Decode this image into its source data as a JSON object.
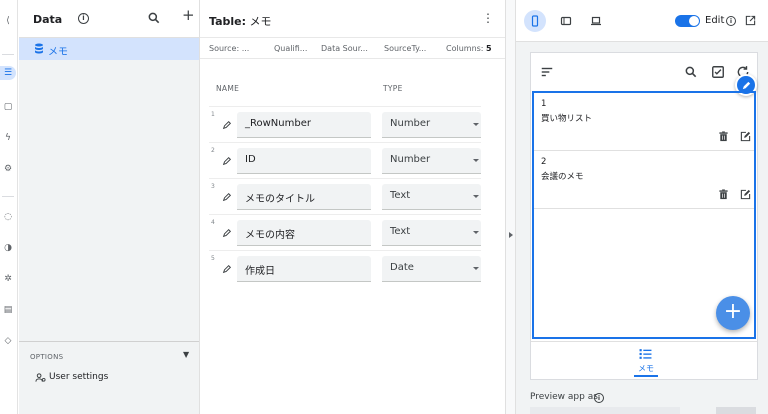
{
  "data_panel": {
    "title": "Data",
    "info_icon": "i",
    "tables": [
      {
        "label": "メモ"
      }
    ],
    "options_label": "OPTIONS",
    "user_settings_label": "User settings"
  },
  "table_panel": {
    "title_prefix": "Table:",
    "title_name": "メモ",
    "meta": {
      "source": "Source: ...",
      "qualifier": "Qualifi...",
      "data_source": "Data Sour...",
      "source_type": "SourceTy...",
      "columns_label": "Columns:",
      "columns_count": "5"
    },
    "headers": {
      "name": "NAME",
      "type": "TYPE"
    },
    "columns": [
      {
        "num": "1",
        "name": "_RowNumber",
        "type": "Number"
      },
      {
        "num": "2",
        "name": "ID",
        "type": "Number"
      },
      {
        "num": "3",
        "name": "メモのタイトル",
        "type": "Text"
      },
      {
        "num": "4",
        "name": "メモの内容",
        "type": "Text"
      },
      {
        "num": "5",
        "name": "作成日",
        "type": "Date"
      }
    ]
  },
  "preview": {
    "edit_label": "Edit",
    "edit_toggle_on": true,
    "info_icon": "i",
    "records": [
      {
        "no": "1",
        "title": "買い物リスト"
      },
      {
        "no": "2",
        "title": "会議のメモ"
      }
    ],
    "fab_add": "+",
    "nav_tab_label": "メモ",
    "preview_as_label": "Preview app as"
  },
  "colors": {
    "accent": "#1a73e8",
    "selected_bg": "#d3e3fd",
    "panel_bg": "#f1f3f4"
  }
}
